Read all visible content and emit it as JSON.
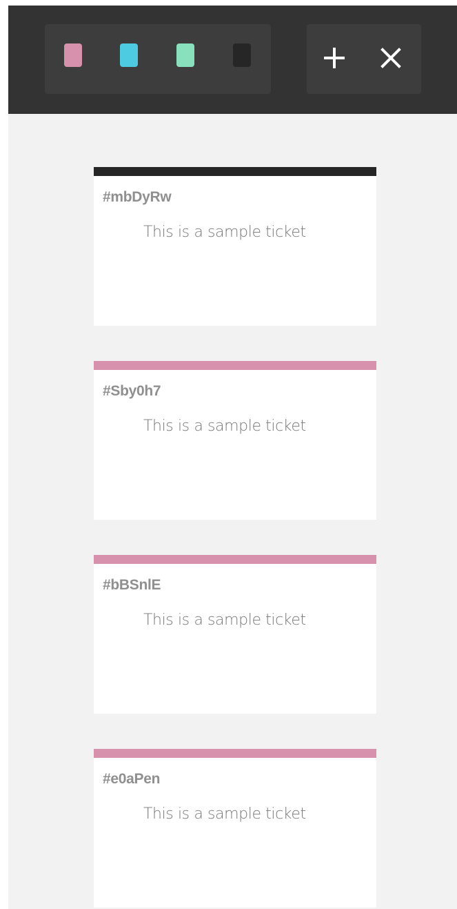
{
  "toolbar": {
    "swatches": [
      {
        "name": "pink",
        "color": "#d891ac"
      },
      {
        "name": "cyan",
        "color": "#4dcbe0"
      },
      {
        "name": "mint",
        "color": "#88e0bd"
      },
      {
        "name": "black",
        "color": "#262626"
      }
    ],
    "add_icon": "plus-icon",
    "close_icon": "close-icon"
  },
  "tickets": [
    {
      "id": "#mbDyRw",
      "text": "This is a sample ticket",
      "color": "#262626"
    },
    {
      "id": "#Sby0h7",
      "text": "This is a sample ticket",
      "color": "#d891ac"
    },
    {
      "id": "#bBSnlE",
      "text": "This is a sample ticket",
      "color": "#d891ac"
    },
    {
      "id": "#e0aPen",
      "text": "This is a sample ticket",
      "color": "#d891ac"
    }
  ]
}
